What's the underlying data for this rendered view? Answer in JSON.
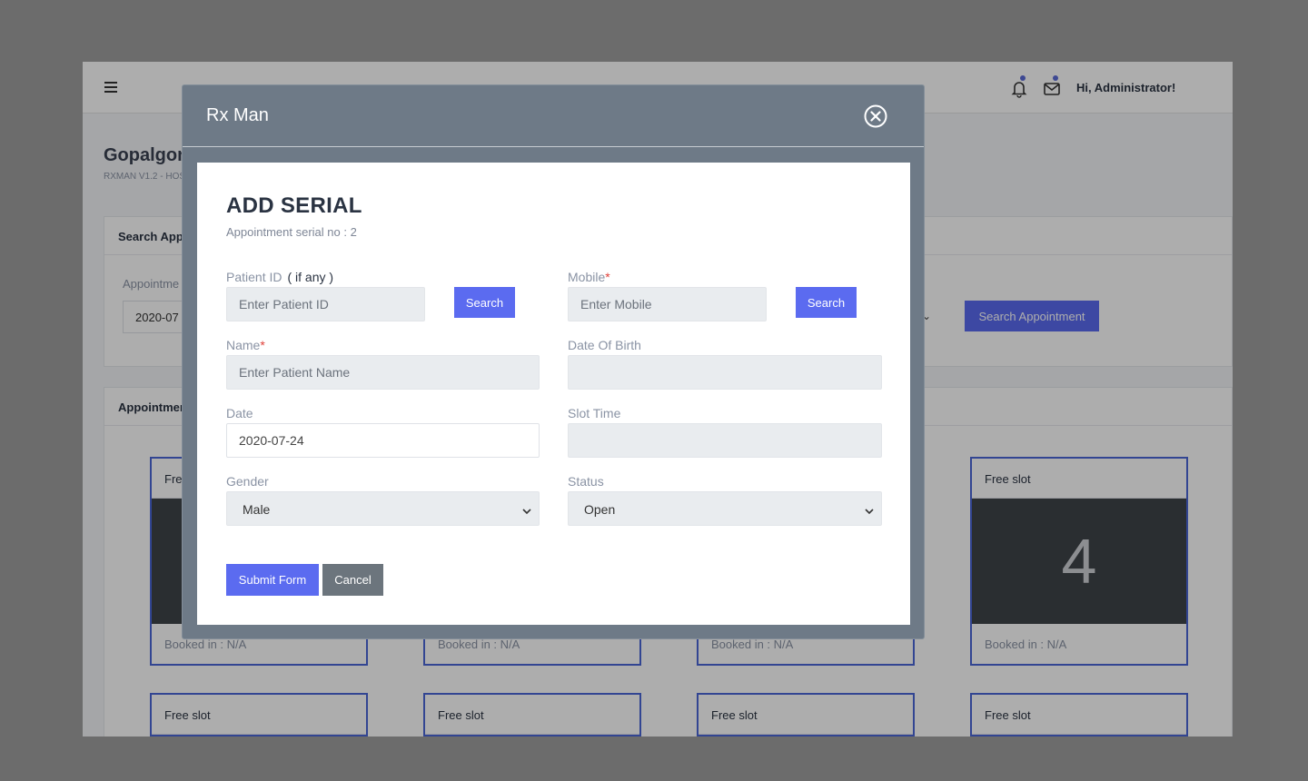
{
  "topbar": {
    "greeting": "Hi, Administrator!"
  },
  "page": {
    "org_name": "Gopalgon",
    "org_sub": "RXMAN V1.2 - HOS",
    "search_card_title": "Search App",
    "appointment_label": "Appointme",
    "appointment_date": "2020-07",
    "search_appointment_button": "Search Appointment",
    "appointments_card_title": "Appointmen"
  },
  "slots_row1": [
    {
      "head": "Fre",
      "number": "",
      "foot": "Booked in : N/A"
    },
    {
      "head": "",
      "number": "",
      "foot": "Booked in : N/A"
    },
    {
      "head": "",
      "number": "",
      "foot": "Booked in : N/A"
    },
    {
      "head": "Free slot",
      "number": "4",
      "foot": "Booked in : N/A"
    }
  ],
  "slots_row2": [
    {
      "head": "Free slot"
    },
    {
      "head": "Free slot"
    },
    {
      "head": "Free slot"
    },
    {
      "head": "Free slot"
    }
  ],
  "modal": {
    "title": "Rx Man",
    "form_title": "ADD SERIAL",
    "form_sub": "Appointment serial no : 2",
    "patient_id_label": "Patient ID",
    "patient_id_hint": "( if any )",
    "patient_id_placeholder": "Enter Patient ID",
    "patient_search_button": "Search",
    "mobile_label": "Mobile",
    "required_mark": "*",
    "mobile_placeholder": "Enter Mobile",
    "mobile_search_button": "Search",
    "name_label": "Name",
    "name_placeholder": "Enter Patient Name",
    "dob_label": "Date Of Birth",
    "date_label": "Date",
    "date_value": "2020-07-24",
    "slot_time_label": "Slot Time",
    "gender_label": "Gender",
    "gender_value": "Male",
    "status_label": "Status",
    "status_value": "Open",
    "submit_button": "Submit Form",
    "cancel_button": "Cancel"
  },
  "colors": {
    "primary": "#5b6bf0",
    "secondary": "#6c757d",
    "modal_bg": "#6e7a87",
    "required": "#e0413a"
  }
}
